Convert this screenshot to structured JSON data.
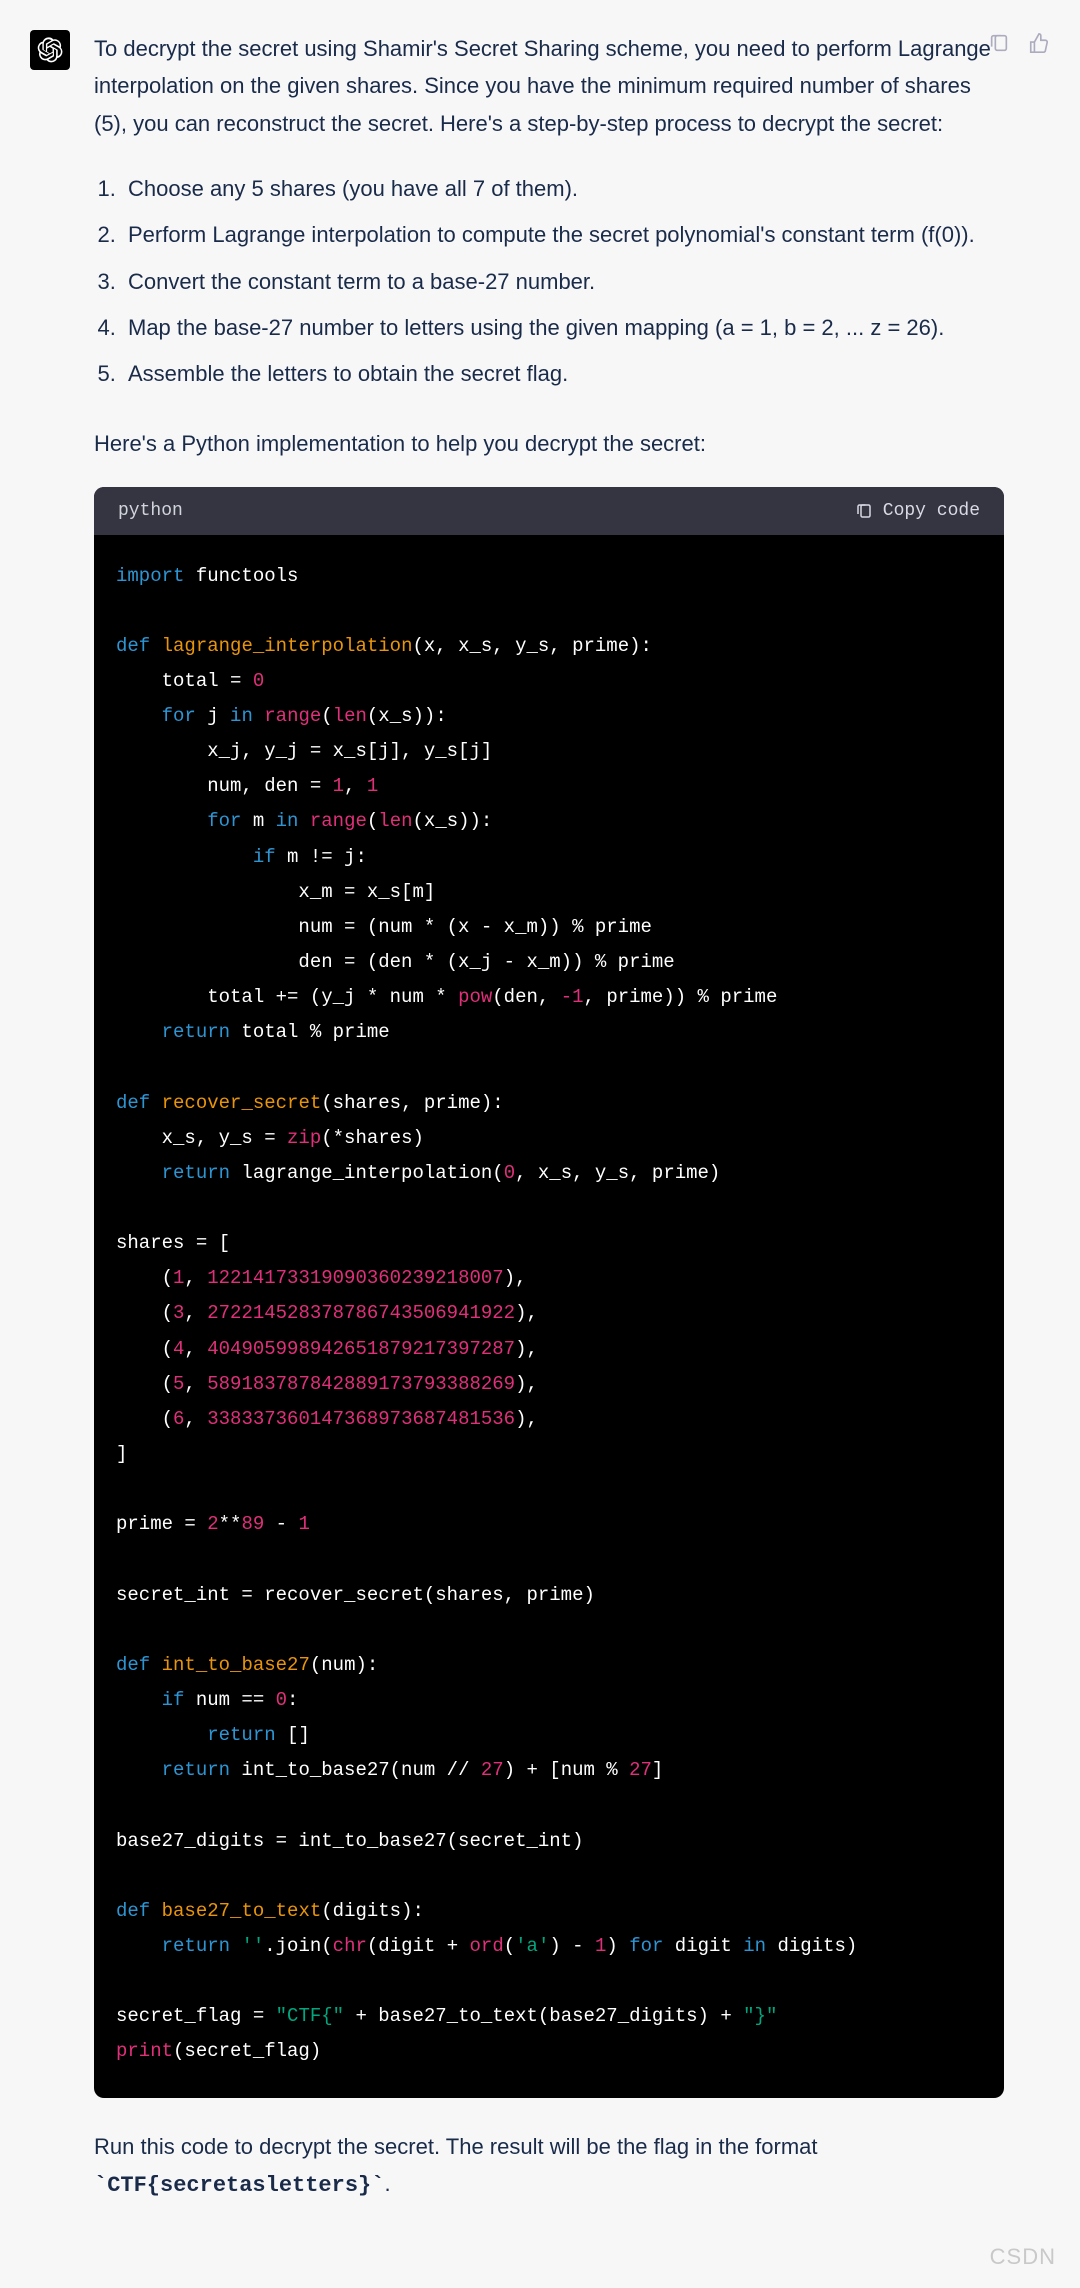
{
  "actions": {
    "copy_icon_name": "copy-icon",
    "like_icon_name": "thumbs-up-icon"
  },
  "avatar": {
    "name": "assistant-avatar"
  },
  "intro_paragraph": "To decrypt the secret using Shamir's Secret Sharing scheme, you need to perform Lagrange interpolation on the given shares. Since you have the minimum required number of shares (5), you can reconstruct the secret. Here's a step-by-step process to decrypt the secret:",
  "steps": [
    "Choose any 5 shares (you have all 7 of them).",
    "Perform Lagrange interpolation to compute the secret polynomial's constant term (f(0)).",
    "Convert the constant term to a base-27 number.",
    "Map the base-27 number to letters using the given mapping (a = 1, b = 2, ... z = 26).",
    "Assemble the letters to obtain the secret flag."
  ],
  "lead_in": "Here's a Python implementation to help you decrypt the secret:",
  "codeblock": {
    "language_label": "python",
    "copy_label": "Copy code",
    "tokens": [
      [
        "kw",
        "import"
      ],
      [
        "",
        " functools\n\n"
      ],
      [
        "kw",
        "def"
      ],
      [
        "",
        " "
      ],
      [
        "fn",
        "lagrange_interpolation"
      ],
      [
        "",
        "(x, x_s, y_s, prime):\n"
      ],
      [
        "",
        "    total = "
      ],
      [
        "num",
        "0"
      ],
      [
        "",
        "\n"
      ],
      [
        "",
        "    "
      ],
      [
        "kw",
        "for"
      ],
      [
        "",
        " j "
      ],
      [
        "kw",
        "in"
      ],
      [
        "",
        " "
      ],
      [
        "call",
        "range"
      ],
      [
        "",
        "("
      ],
      [
        "call",
        "len"
      ],
      [
        "",
        "(x_s)):\n"
      ],
      [
        "",
        "        x_j, y_j = x_s[j], y_s[j]\n"
      ],
      [
        "",
        "        num, den = "
      ],
      [
        "num",
        "1"
      ],
      [
        "",
        ", "
      ],
      [
        "num",
        "1"
      ],
      [
        "",
        "\n"
      ],
      [
        "",
        "        "
      ],
      [
        "kw",
        "for"
      ],
      [
        "",
        " m "
      ],
      [
        "kw",
        "in"
      ],
      [
        "",
        " "
      ],
      [
        "call",
        "range"
      ],
      [
        "",
        "("
      ],
      [
        "call",
        "len"
      ],
      [
        "",
        "(x_s)):\n"
      ],
      [
        "",
        "            "
      ],
      [
        "kw",
        "if"
      ],
      [
        "",
        " m != j:\n"
      ],
      [
        "",
        "                x_m = x_s[m]\n"
      ],
      [
        "",
        "                num = (num * (x - x_m)) % prime\n"
      ],
      [
        "",
        "                den = (den * (x_j - x_m)) % prime\n"
      ],
      [
        "",
        "        total += (y_j * num * "
      ],
      [
        "call",
        "pow"
      ],
      [
        "",
        "(den, "
      ],
      [
        "num",
        "-1"
      ],
      [
        "",
        ", prime)) % prime\n"
      ],
      [
        "",
        "    "
      ],
      [
        "kw",
        "return"
      ],
      [
        "",
        " total % prime\n\n"
      ],
      [
        "kw",
        "def"
      ],
      [
        "",
        " "
      ],
      [
        "fn",
        "recover_secret"
      ],
      [
        "",
        "(shares, prime):\n"
      ],
      [
        "",
        "    x_s, y_s = "
      ],
      [
        "call",
        "zip"
      ],
      [
        "",
        "(*shares)\n"
      ],
      [
        "",
        "    "
      ],
      [
        "kw",
        "return"
      ],
      [
        "",
        " lagrange_interpolation("
      ],
      [
        "num",
        "0"
      ],
      [
        "",
        ", x_s, y_s, prime)\n\n"
      ],
      [
        "",
        "shares = [\n"
      ],
      [
        "",
        "    ("
      ],
      [
        "num",
        "1"
      ],
      [
        "",
        ", "
      ],
      [
        "num",
        "1221417331909036023921800"
      ],
      [
        "num",
        "7"
      ],
      [
        "",
        "),\n"
      ],
      [
        "",
        "    ("
      ],
      [
        "num",
        "3"
      ],
      [
        "",
        ", "
      ],
      [
        "num",
        "2722145283787867435069419"
      ],
      [
        "num",
        "22"
      ],
      [
        "",
        "),\n"
      ],
      [
        "",
        "    ("
      ],
      [
        "num",
        "4"
      ],
      [
        "",
        ", "
      ],
      [
        "num",
        "4049059989426518792173972"
      ],
      [
        "num",
        "87"
      ],
      [
        "",
        "),\n"
      ],
      [
        "",
        "    ("
      ],
      [
        "num",
        "5"
      ],
      [
        "",
        ", "
      ],
      [
        "num",
        "5891837878428891737933882"
      ],
      [
        "num",
        "69"
      ],
      [
        "",
        "),\n"
      ],
      [
        "",
        "    ("
      ],
      [
        "num",
        "6"
      ],
      [
        "",
        ", "
      ],
      [
        "num",
        "3383373601473689736874815"
      ],
      [
        "num",
        "36"
      ],
      [
        "",
        "),\n"
      ],
      [
        "",
        "]\n\n"
      ],
      [
        "",
        "prime = "
      ],
      [
        "num",
        "2"
      ],
      [
        "",
        "**"
      ],
      [
        "num",
        "89"
      ],
      [
        "",
        " - "
      ],
      [
        "num",
        "1"
      ],
      [
        "",
        "\n\n"
      ],
      [
        "",
        "secret_int = recover_secret(shares, prime)\n\n"
      ],
      [
        "kw",
        "def"
      ],
      [
        "",
        " "
      ],
      [
        "fn",
        "int_to_base27"
      ],
      [
        "",
        "(num):\n"
      ],
      [
        "",
        "    "
      ],
      [
        "kw",
        "if"
      ],
      [
        "",
        " num == "
      ],
      [
        "num",
        "0"
      ],
      [
        "",
        ":\n"
      ],
      [
        "",
        "        "
      ],
      [
        "kw",
        "return"
      ],
      [
        "",
        " []\n"
      ],
      [
        "",
        "    "
      ],
      [
        "kw",
        "return"
      ],
      [
        "",
        " int_to_base27(num // "
      ],
      [
        "num",
        "27"
      ],
      [
        "",
        ") + [num % "
      ],
      [
        "num",
        "27"
      ],
      [
        "",
        "]\n\n"
      ],
      [
        "",
        "base27_digits = int_to_base27(secret_int)\n\n"
      ],
      [
        "kw",
        "def"
      ],
      [
        "",
        " "
      ],
      [
        "fn",
        "base27_to_text"
      ],
      [
        "",
        "(digits):\n"
      ],
      [
        "",
        "    "
      ],
      [
        "kw",
        "return"
      ],
      [
        "",
        " "
      ],
      [
        "str",
        "''"
      ],
      [
        "",
        ".join("
      ],
      [
        "call",
        "chr"
      ],
      [
        "",
        "(digit + "
      ],
      [
        "call",
        "ord"
      ],
      [
        "",
        "("
      ],
      [
        "str",
        "'a'"
      ],
      [
        "",
        ") - "
      ],
      [
        "num",
        "1"
      ],
      [
        "",
        ") "
      ],
      [
        "kw",
        "for"
      ],
      [
        "",
        " digit "
      ],
      [
        "kw",
        "in"
      ],
      [
        "",
        " digits)\n\n"
      ],
      [
        "",
        "secret_flag = "
      ],
      [
        "str",
        "\"CTF{\""
      ],
      [
        "",
        " + base27_to_text(base27_digits) + "
      ],
      [
        "str",
        "\"}\""
      ],
      [
        "",
        "\n"
      ],
      [
        "call",
        "print"
      ],
      [
        "",
        "(secret_flag)"
      ]
    ]
  },
  "outro_1": "Run this code to decrypt the secret. The result will be the flag in the format",
  "outro_code": "`CTF{secretasletters}`",
  "outro_2": ".",
  "watermark": "CSDN"
}
